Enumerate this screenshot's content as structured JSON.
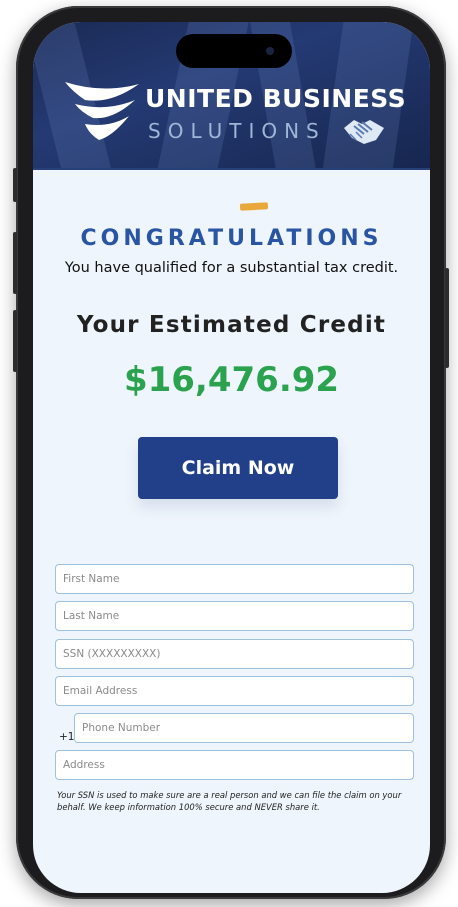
{
  "header": {
    "brand_line1": "UNITED BUSINESS",
    "brand_line2": "SOLUTIONS",
    "logo_icon": "wing-logo-icon",
    "handshake_icon": "handshake-icon"
  },
  "hero": {
    "congrats": "CONGRATULATIONS",
    "qualified": "You have qualified for a substantial tax credit.",
    "estimate_title": "Your Estimated Credit",
    "amount": "$16,476.92",
    "claim_label": "Claim Now"
  },
  "form": {
    "first_name": {
      "placeholder": "First Name",
      "value": ""
    },
    "last_name": {
      "placeholder": "Last Name",
      "value": ""
    },
    "ssn": {
      "placeholder": "SSN (XXXXXXXXX)",
      "value": ""
    },
    "email": {
      "placeholder": "Email Address",
      "value": ""
    },
    "phone_prefix": "+1",
    "phone": {
      "placeholder": "Phone Number",
      "value": ""
    },
    "address": {
      "placeholder": "Address",
      "value": ""
    },
    "disclaimer": "Your SSN is used to make sure are a real person and we can file the claim on your behalf. We keep information 100% secure and NEVER share it."
  },
  "colors": {
    "accent_blue": "#2a55a3",
    "button_blue": "#22408a",
    "amount_green": "#2aa24e",
    "header_navy": "#1b2a55"
  }
}
